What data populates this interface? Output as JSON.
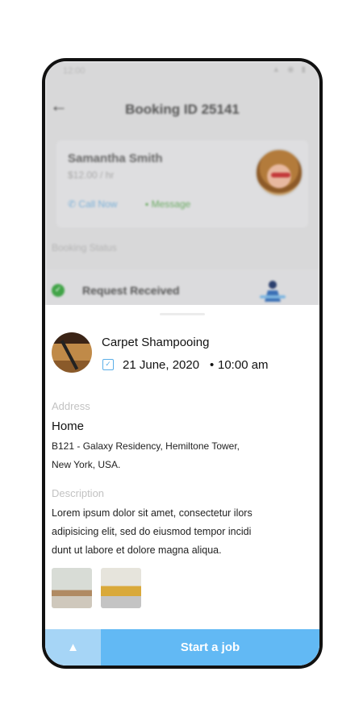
{
  "status_bar": {
    "time": "12:00",
    "icons": "▲ ◉ ▮"
  },
  "header": {
    "title": "Booking ID 25141"
  },
  "provider": {
    "name": "Samantha Smith",
    "rate": "$12.00 / hr",
    "call_label": "Call Now",
    "message_label": "Message"
  },
  "booking_status": {
    "label": "Booking Status",
    "current": "Request Received"
  },
  "service": {
    "name": "Carpet Shampooing",
    "date": "21 June, 2020",
    "separator": "•",
    "time": "10:00 am"
  },
  "address": {
    "label": "Address",
    "title": "Home",
    "lines": [
      "B121 - Galaxy Residency, Hemiltone Tower,",
      "New York, USA."
    ]
  },
  "description": {
    "label": "Description",
    "lines": [
      "Lorem ipsum dolor sit amet, consectetur ilors",
      "adipisicing elit, sed do eiusmod tempor incidi",
      "dunt ut labore et dolore magna aliqua."
    ]
  },
  "actions": {
    "navigate_icon": "▲",
    "start_label": "Start a job"
  },
  "colors": {
    "accent": "#62b9f4",
    "accent_light": "#a6d5f6",
    "success": "#41a447"
  }
}
